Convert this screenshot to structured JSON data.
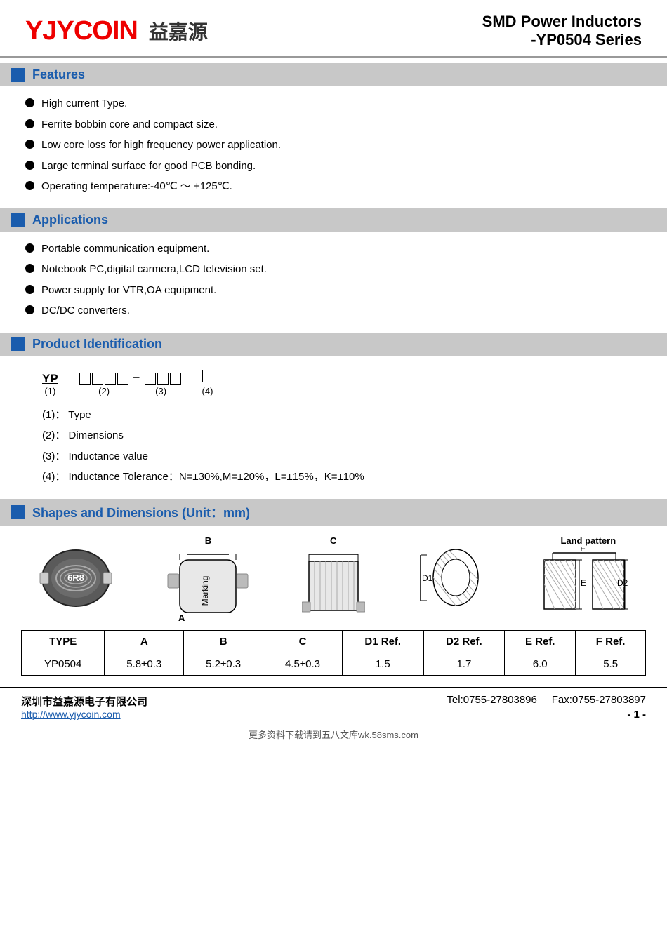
{
  "header": {
    "logo_red": "YJYCOIN",
    "logo_cn": "益嘉源",
    "title_line1": "SMD Power Inductors",
    "title_line2": "-YP0504 Series"
  },
  "features": {
    "section_title": "Features",
    "items": [
      "High current Type.",
      "Ferrite bobbin core and compact size.",
      "Low core loss for high frequency power application.",
      "Large terminal surface for good PCB bonding.",
      "Operating temperature:-40℃ ～ +125℃."
    ]
  },
  "applications": {
    "section_title": "Applications",
    "items": [
      "Portable communication equipment.",
      "Notebook PC,digital carmera,LCD television set.",
      "Power supply for VTR,OA equipment.",
      "DC/DC converters."
    ]
  },
  "product_id": {
    "section_title": "Product Identification",
    "legend": [
      {
        "num": "(1)：",
        "desc": "Type"
      },
      {
        "num": "(2)：",
        "desc": "Dimensions"
      },
      {
        "num": "(3)：",
        "desc": "Inductance value"
      },
      {
        "num": "(4)：",
        "desc": "Inductance Tolerance：N=±30%,M=±20%，L=±15%，K=±10%"
      }
    ]
  },
  "shapes": {
    "section_title": "Shapes and Dimensions (Unit：mm)",
    "land_pattern_label": "Land pattern",
    "labels": {
      "b_label": "B",
      "c_label": "C",
      "d1_label": "D1",
      "d2_label": "D2",
      "e_label": "E",
      "f_label": "F",
      "a_label": "A",
      "marking_label": "Marking"
    }
  },
  "table": {
    "headers": [
      "TYPE",
      "A",
      "B",
      "C",
      "D1 Ref.",
      "D2 Ref.",
      "E Ref.",
      "F Ref."
    ],
    "rows": [
      [
        "YP0504",
        "5.8±0.3",
        "5.2±0.3",
        "4.5±0.3",
        "1.5",
        "1.7",
        "6.0",
        "5.5"
      ]
    ]
  },
  "footer": {
    "company": "深圳市益嘉源电子有限公司",
    "website": "http://www.yjycoin.com",
    "tel": "Tel:0755-27803896",
    "fax": "Fax:0755-27803897",
    "page": "- 1 -"
  },
  "watermark": "更多资料下载请到五八文库wk.58sms.com"
}
